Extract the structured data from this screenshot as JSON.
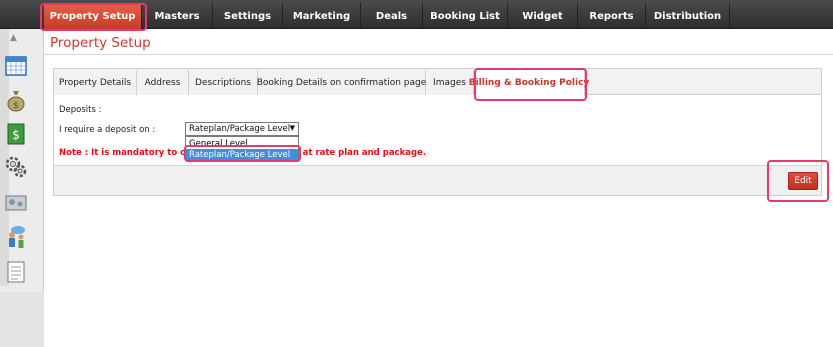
{
  "topnav": {
    "items": [
      {
        "label": "Property Setup"
      },
      {
        "label": "Masters"
      },
      {
        "label": "Settings"
      },
      {
        "label": "Marketing"
      },
      {
        "label": "Deals"
      },
      {
        "label": "Booking List"
      },
      {
        "label": "Widget"
      },
      {
        "label": "Reports"
      },
      {
        "label": "Distribution"
      }
    ]
  },
  "page": {
    "title": "Property Setup"
  },
  "tabs": [
    {
      "label": "Property Details"
    },
    {
      "label": "Address"
    },
    {
      "label": "Descriptions"
    },
    {
      "label": "Booking Details on confirmation page"
    },
    {
      "label": "Images"
    },
    {
      "label": "Billing & Booking Policy"
    }
  ],
  "content": {
    "deposits_label": "Deposits :",
    "deposit_on_label": "I require a deposit on :",
    "deposit_select_value": "Rateplan/Package Level",
    "deposit_options": [
      "General Level",
      "Rateplan/Package Level"
    ],
    "note": "Note : It is mandatory to configure deposit details at rate plan and package."
  },
  "actions": {
    "edit_label": "Edit"
  },
  "colors": {
    "accent": "#cc3a2c",
    "highlight": "#e8396a",
    "selection": "#3e8fe0"
  },
  "sidebar": {
    "icons": [
      "calendar-icon",
      "money-bag-icon",
      "dollar-note-icon",
      "gear-icon",
      "widget-icon",
      "users-icon",
      "document-icon"
    ]
  }
}
